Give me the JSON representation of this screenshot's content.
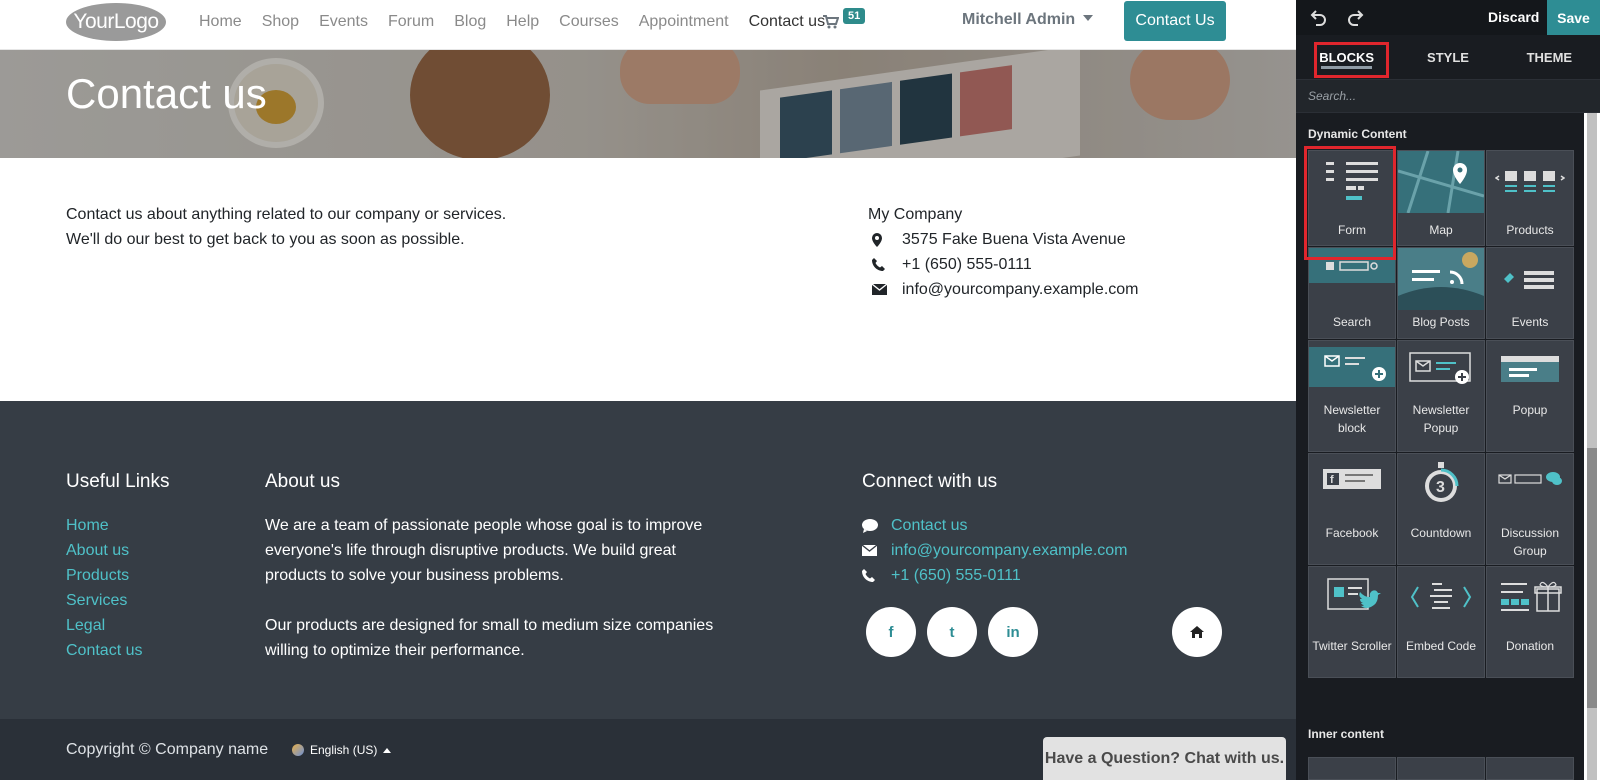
{
  "header": {
    "logo_text": "YourLogo",
    "menu": [
      "Home",
      "Shop",
      "Events",
      "Forum",
      "Blog",
      "Help",
      "Courses",
      "Appointment",
      "Contact us"
    ],
    "active_menu": "Contact us",
    "cart_count": "51",
    "user_name": "Mitchell Admin",
    "cta_label": "Contact Us"
  },
  "banner": {
    "title": "Contact us"
  },
  "contact": {
    "intro_line1": "Contact us about anything related to our company or services.",
    "intro_line2": "We'll do our best to get back to you as soon as possible.",
    "company_name": "My Company",
    "address": "3575 Fake Buena Vista Avenue",
    "phone": "+1 (650) 555-0111",
    "email": "info@yourcompany.example.com"
  },
  "footer": {
    "useful_links_title": "Useful Links",
    "useful_links": [
      "Home",
      "About us",
      "Products",
      "Services",
      "Legal",
      "Contact us"
    ],
    "about_title": "About us",
    "about_p1": "We are a team of passionate people whose goal is to improve everyone's life through disruptive products. We build great products to solve your business problems.",
    "about_p2": "Our products are designed for small to medium size companies willing to optimize their performance.",
    "connect_title": "Connect with us",
    "connect_contact": "Contact us",
    "connect_email": "info@yourcompany.example.com",
    "connect_phone": "+1 (650) 555-0111",
    "social": [
      "f",
      "t",
      "in"
    ],
    "copyright": "Copyright © Company name",
    "language": "English (US)"
  },
  "chat_button": "Have a Question? Chat with us.",
  "editor": {
    "discard_label": "Discard",
    "save_label": "Save",
    "tabs": [
      "BLOCKS",
      "STYLE",
      "THEME"
    ],
    "active_tab": "BLOCKS",
    "search_placeholder": "Search...",
    "dynamic_content_title": "Dynamic Content",
    "blocks": [
      {
        "label": "Form",
        "icon": "form-icon"
      },
      {
        "label": "Map",
        "icon": "map-icon"
      },
      {
        "label": "Products",
        "icon": "products-icon"
      },
      {
        "label": "Search",
        "icon": "search-icon"
      },
      {
        "label": "Blog Posts",
        "icon": "blog-posts-icon"
      },
      {
        "label": "Events",
        "icon": "events-icon"
      },
      {
        "label": "Newsletter block",
        "icon": "newsletter-icon"
      },
      {
        "label": "Newsletter Popup",
        "icon": "newsletter-popup-icon"
      },
      {
        "label": "Popup",
        "icon": "popup-icon"
      },
      {
        "label": "Facebook",
        "icon": "facebook-icon"
      },
      {
        "label": "Countdown",
        "icon": "countdown-icon"
      },
      {
        "label": "Discussion Group",
        "icon": "discussion-group-icon"
      },
      {
        "label": "Twitter Scroller",
        "icon": "twitter-icon"
      },
      {
        "label": "Embed Code",
        "icon": "embed-code-icon"
      },
      {
        "label": "Donation",
        "icon": "donation-icon"
      }
    ],
    "inner_content_title": "Inner content"
  },
  "colors": {
    "accent": "#2e8d94",
    "footer_bg": "#363d45",
    "link": "#4fc1c8",
    "highlight": "#e0262d"
  }
}
